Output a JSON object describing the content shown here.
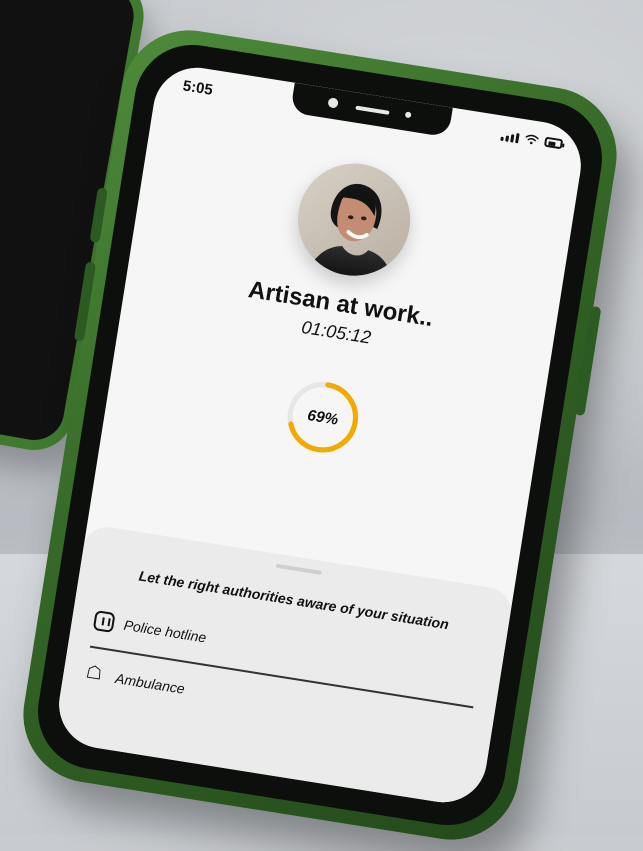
{
  "status_bar": {
    "time": "5:05",
    "signal_icon": "signal-icon",
    "wifi_icon": "wifi-icon",
    "battery_icon": "battery-icon"
  },
  "profile": {
    "avatar_icon": "avatar-photo"
  },
  "main": {
    "title": "Artisan at work..",
    "timer": "01:05:12",
    "progress": {
      "value_percent": 69,
      "label": "69%",
      "accent_color": "#F2A900"
    }
  },
  "bottom_sheet": {
    "message": "Let the right authorities aware of your situation",
    "items": [
      {
        "label": "Police hotline",
        "icon": "police-icon"
      },
      {
        "label": "Ambulance",
        "icon": "ambulance-icon"
      }
    ]
  },
  "colors": {
    "phone_green": "#3F7A2F",
    "screen_bg": "#F6F6F6",
    "sheet_bg": "#EBEBEB",
    "text": "#111111"
  }
}
